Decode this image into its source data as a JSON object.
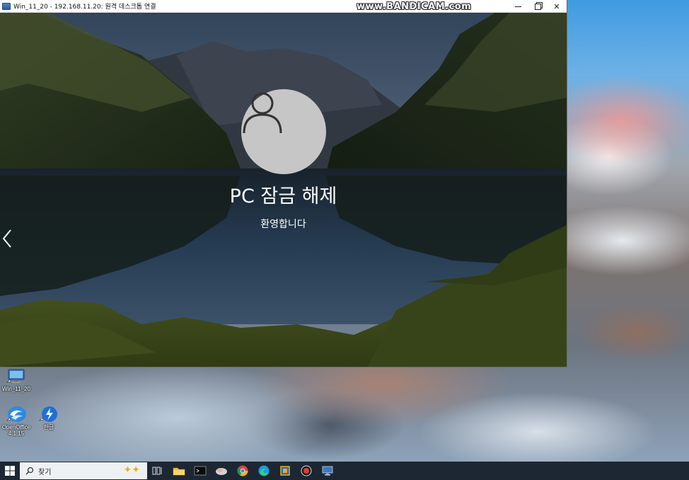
{
  "window": {
    "title": "Win_11_20 - 192.168.11.20: 원격 데스크톱 연결",
    "watermark": "www.BANDICAM.com"
  },
  "lockscreen": {
    "title": "PC 잠금 해제",
    "subtitle": "환영합니다"
  },
  "desktop": {
    "icons": [
      {
        "label": "Win_11_20",
        "icon": "remote-desktop-icon"
      },
      {
        "label": "OpenOffice 4.1.15",
        "icon": "openoffice-icon"
      },
      {
        "label": "한글",
        "icon": "hanword-icon"
      }
    ]
  },
  "taskbar": {
    "search_placeholder": "찾기",
    "apps": [
      "task-view-icon",
      "file-explorer-icon",
      "terminal-icon",
      "cloud-app-icon",
      "chrome-icon",
      "edge-icon",
      "virtualbox-icon",
      "record-icon",
      "remote-desktop-icon"
    ]
  },
  "colors": {
    "taskbar": "#1c2733",
    "avatar_bg": "#c6c6c6",
    "titlebar": "#ffffff"
  }
}
